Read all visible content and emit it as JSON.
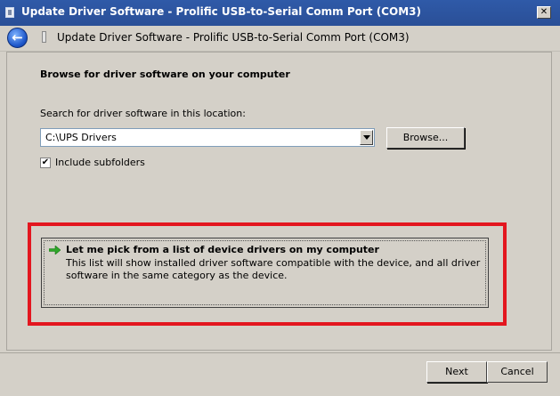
{
  "window": {
    "title": "Update Driver Software - Prolific USB-to-Serial Comm Port (COM3)",
    "close_label": "✕"
  },
  "nav": {
    "back_icon": "back-arrow-icon",
    "title": "Update Driver Software - Prolific USB-to-Serial Comm Port (COM3)"
  },
  "main": {
    "heading": "Browse for driver software on your computer",
    "search_label": "Search for driver software in this location:",
    "path_value": "C:\\UPS Drivers",
    "browse_label": "Browse...",
    "include_subfolders_label": "Include subfolders",
    "include_subfolders_checked": true,
    "check_mark": "✔"
  },
  "option": {
    "title": "Let me pick from a list of device drivers on my computer",
    "description": "This list will show installed driver software compatible with the device, and all driver software in the same category as the device.",
    "arrow_color": "#2fa62a"
  },
  "highlight_color": "#e3161f",
  "footer": {
    "next_label": "Next",
    "cancel_label": "Cancel"
  }
}
